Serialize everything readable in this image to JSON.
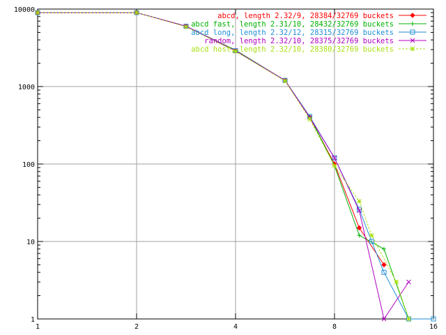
{
  "chart_data": {
    "type": "line",
    "xscale": "log2",
    "yscale": "log10",
    "xlim": [
      1,
      16
    ],
    "ylim": [
      1,
      10000
    ],
    "grid": true,
    "legend_position": "top-right",
    "x_ticks": [
      {
        "value": 1,
        "label": "1"
      },
      {
        "value": 2,
        "label": "2"
      },
      {
        "value": 4,
        "label": "4"
      },
      {
        "value": 8,
        "label": "8"
      },
      {
        "value": 16,
        "label": "16"
      }
    ],
    "y_ticks": [
      {
        "value": 1,
        "label": "1"
      },
      {
        "value": 10,
        "label": "10"
      },
      {
        "value": 100,
        "label": "100"
      },
      {
        "value": 1000,
        "label": "1000"
      },
      {
        "value": 10000,
        "label": "10000"
      }
    ],
    "series": [
      {
        "name": "abcd, length 2.32/9, 28384/32769 buckets",
        "color": "#ff0000",
        "marker": "diamond",
        "points": [
          [
            1,
            9000
          ],
          [
            2,
            9000
          ],
          [
            2.828,
            6000
          ],
          [
            4,
            2900
          ],
          [
            5.657,
            1200
          ],
          [
            6.727,
            400
          ],
          [
            8,
            100
          ],
          [
            9.514,
            15
          ],
          [
            11.314,
            5
          ]
        ]
      },
      {
        "name": "abcd fast, length 2.31/10, 28432/32769 buckets",
        "color": "#00b000",
        "marker": "plus",
        "points": [
          [
            1,
            9000
          ],
          [
            2,
            9000
          ],
          [
            2.828,
            6000
          ],
          [
            4,
            2950
          ],
          [
            5.657,
            1200
          ],
          [
            6.727,
            410
          ],
          [
            8,
            95
          ],
          [
            9.514,
            12
          ],
          [
            11.314,
            8
          ],
          [
            13.454,
            1
          ]
        ]
      },
      {
        "name": "abcd long, length 2.32/12, 28315/32769 buckets",
        "color": "#1f8ed6",
        "marker": "square",
        "points": [
          [
            1,
            9000
          ],
          [
            2,
            9000
          ],
          [
            2.828,
            6000
          ],
          [
            4,
            2900
          ],
          [
            5.657,
            1200
          ],
          [
            6.727,
            410
          ],
          [
            8,
            120
          ],
          [
            9.514,
            26
          ],
          [
            10.375,
            10
          ],
          [
            11.314,
            4
          ],
          [
            13.454,
            1
          ],
          [
            16,
            1
          ]
        ]
      },
      {
        "name": "random, length 2.32/10, 28375/32769 buckets",
        "color": "#b000c0",
        "marker": "x",
        "points": [
          [
            1,
            9000
          ],
          [
            2,
            9000
          ],
          [
            2.828,
            6000
          ],
          [
            4,
            2900
          ],
          [
            5.657,
            1200
          ],
          [
            6.727,
            400
          ],
          [
            8,
            120
          ],
          [
            9.514,
            25
          ],
          [
            11.314,
            1
          ],
          [
            13.454,
            3
          ]
        ]
      },
      {
        "name": "abcd host, length 2.32/10, 28380/32769 buckets",
        "color": "#a8e010",
        "marker": "star",
        "dashed": true,
        "points": [
          [
            1,
            9000
          ],
          [
            2,
            9000
          ],
          [
            2.828,
            5900
          ],
          [
            4,
            2850
          ],
          [
            5.657,
            1180
          ],
          [
            6.727,
            380
          ],
          [
            8,
            95
          ],
          [
            9.514,
            33
          ],
          [
            10.375,
            12
          ],
          [
            12.337,
            3
          ],
          [
            13.454,
            1
          ]
        ]
      }
    ]
  }
}
